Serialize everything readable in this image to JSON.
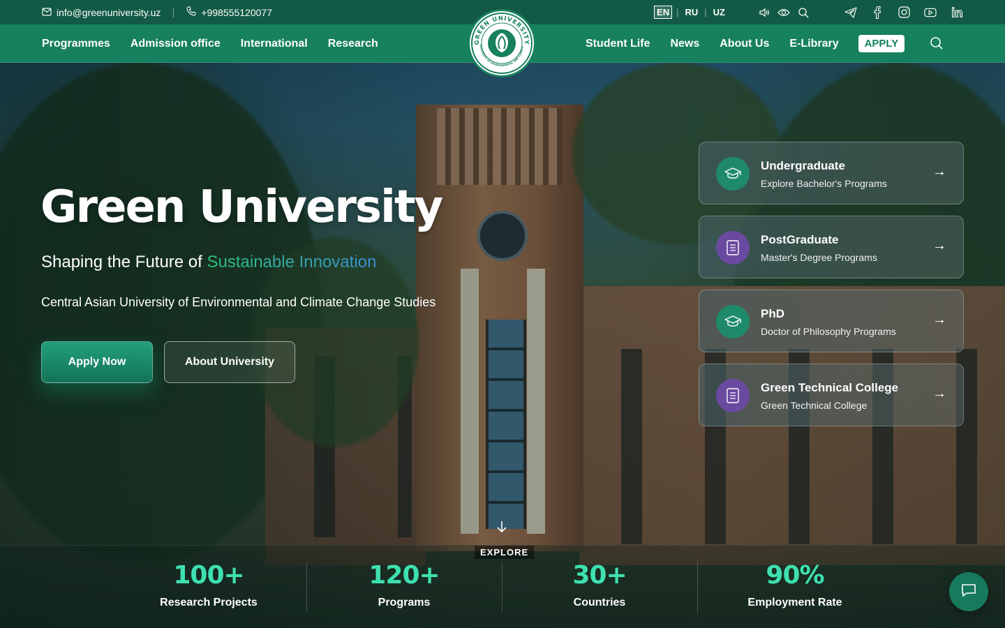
{
  "topbar": {
    "email": "info@greenuniversity.uz",
    "phone": "+998555120077",
    "languages": [
      {
        "code": "EN",
        "active": true
      },
      {
        "code": "RU",
        "active": false
      },
      {
        "code": "UZ",
        "active": false
      }
    ],
    "accessibility_icons": [
      "volume-icon",
      "eye-icon",
      "search-icon"
    ],
    "social_icons": [
      "telegram-icon",
      "facebook-icon",
      "instagram-icon",
      "youtube-icon",
      "linkedin-icon"
    ]
  },
  "nav": {
    "left": [
      "Programmes",
      "Admission office",
      "International",
      "Research"
    ],
    "right": [
      "Student Life",
      "News",
      "About Us",
      "E-Library"
    ],
    "apply_label": "APPLY"
  },
  "logo": {
    "ring_text": "GREEN UNIVERSITY",
    "inner_text": "CENTRAL ASIAN UNIVERSITY OF ENVIRONMENTAL AND CLIMATE CHANGE STUDIES"
  },
  "hero": {
    "title": "Green University",
    "subtitle_prefix": "Shaping the Future of",
    "subtitle_highlight": "Sustainable Innovation",
    "description": "Central Asian University of Environmental and Climate Change Studies",
    "primary_cta": "Apply Now",
    "secondary_cta": "About University",
    "explore_label": "EXPLORE"
  },
  "programs": [
    {
      "title": "Undergraduate",
      "subtitle": "Explore Bachelor's Programs",
      "icon": "graduation-cap-icon",
      "color": "green"
    },
    {
      "title": "PostGraduate",
      "subtitle": "Master's Degree Programs",
      "icon": "document-icon",
      "color": "purple"
    },
    {
      "title": "PhD",
      "subtitle": "Doctor of Philosophy Programs",
      "icon": "graduation-cap-icon",
      "color": "green"
    },
    {
      "title": "Green Technical College",
      "subtitle": "Green Technical College",
      "icon": "document-icon",
      "color": "purple"
    }
  ],
  "stats": [
    {
      "value": "100+",
      "label": "Research Projects"
    },
    {
      "value": "120+",
      "label": "Programs"
    },
    {
      "value": "30+",
      "label": "Countries"
    },
    {
      "value": "90%",
      "label": "Employment Rate"
    }
  ],
  "colors": {
    "topbar": "#125a45",
    "nav": "#17805f",
    "accent": "#3ee0b0",
    "purple": "#6a4aa0"
  }
}
